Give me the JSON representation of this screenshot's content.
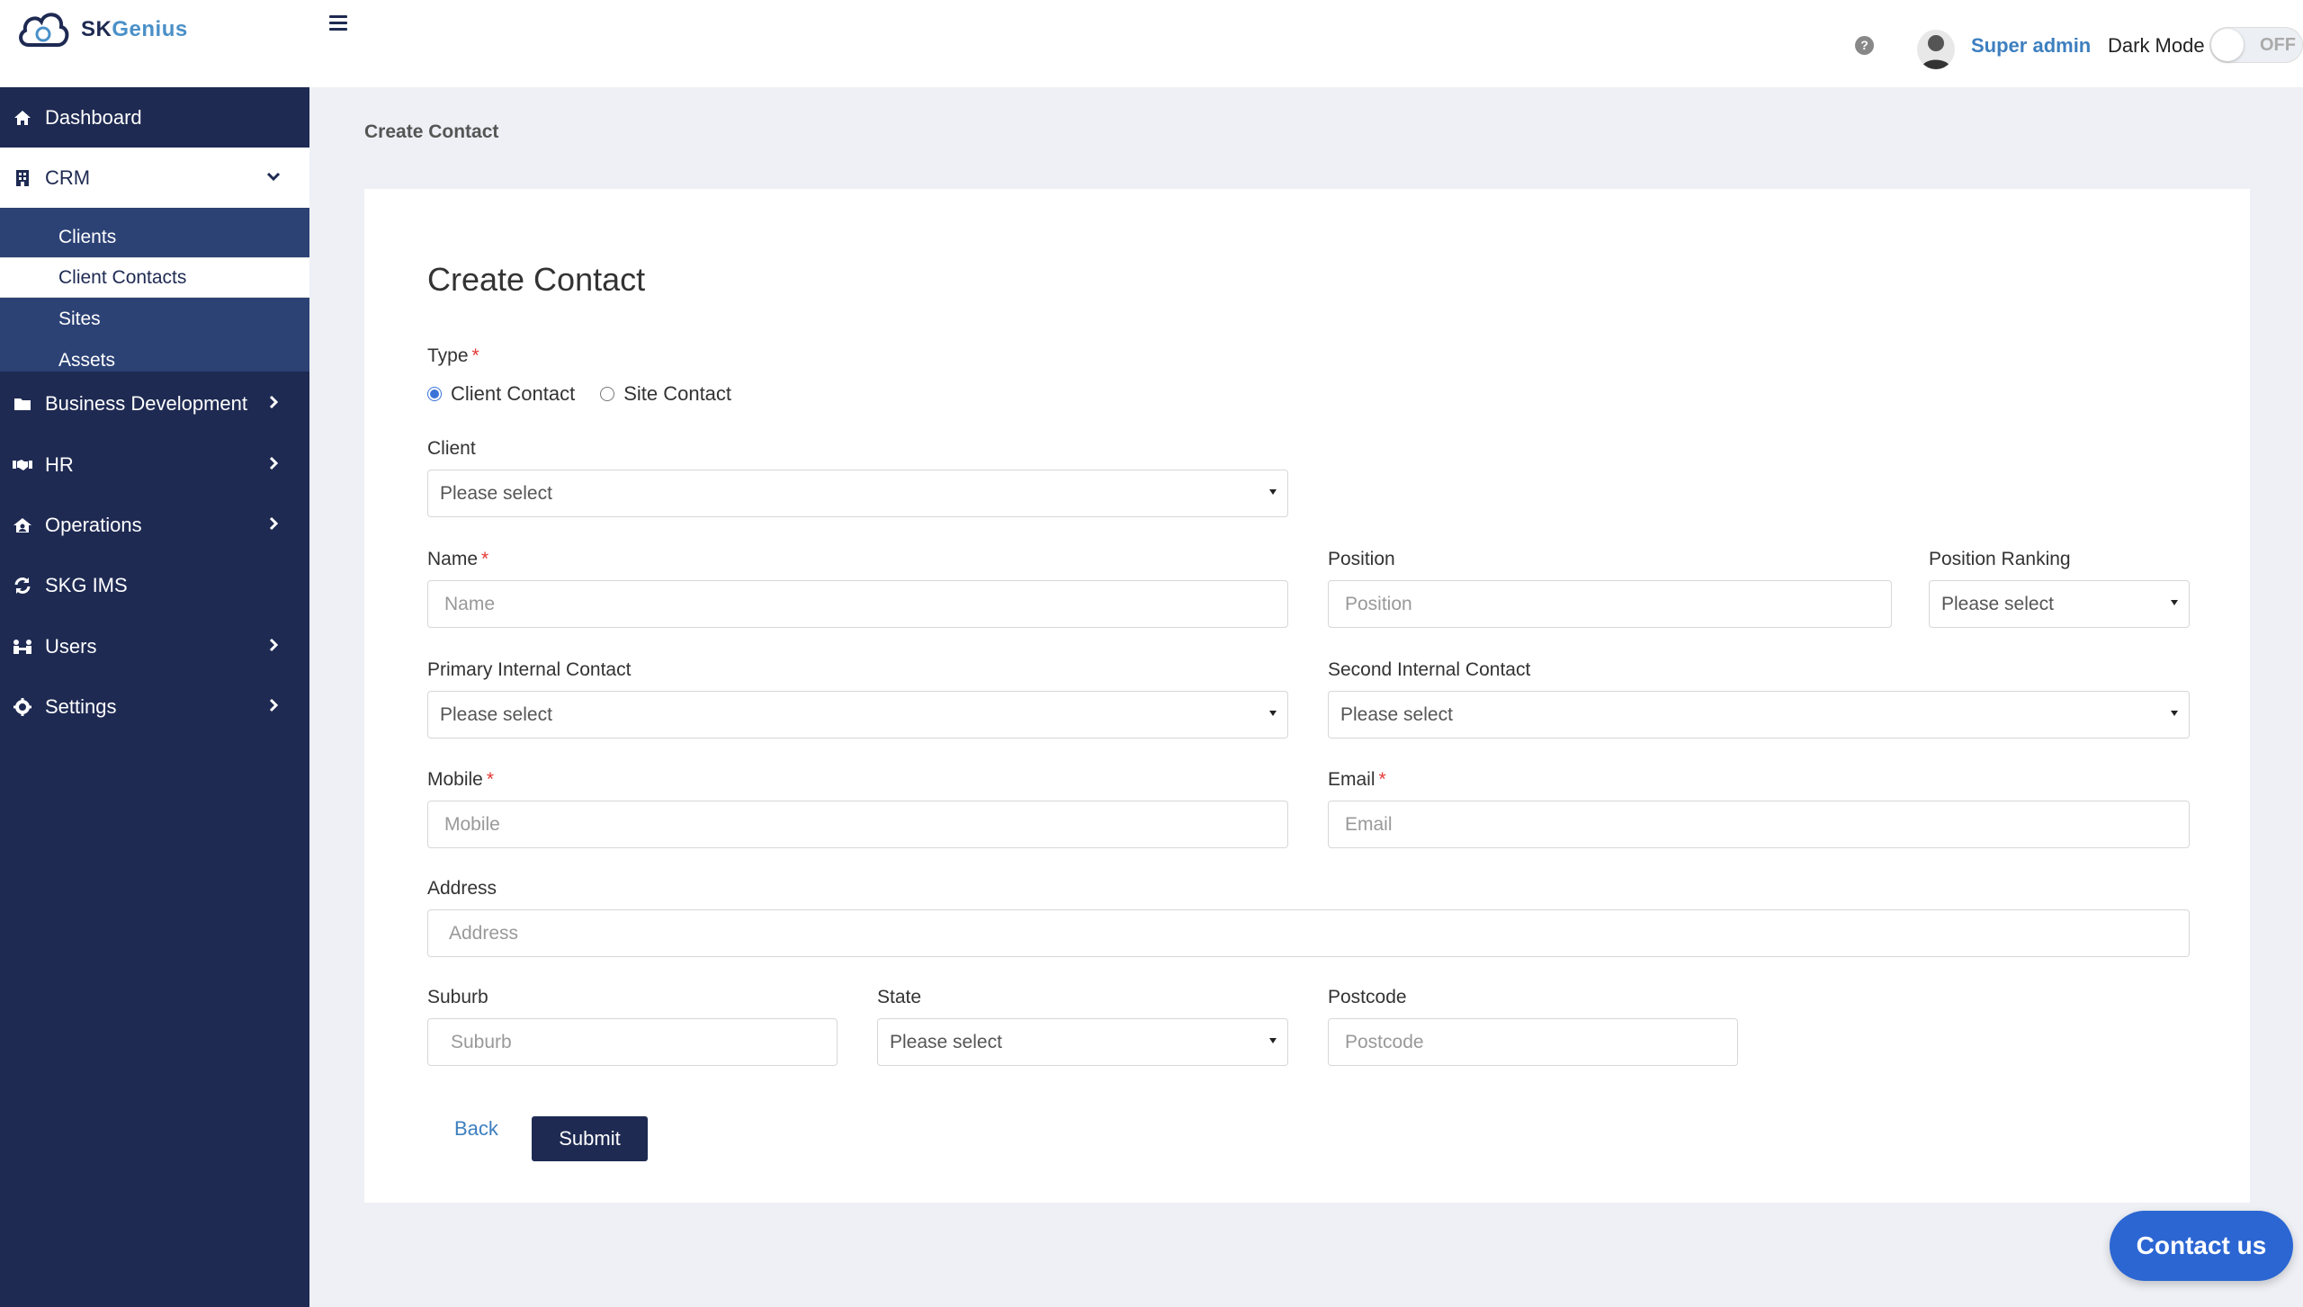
{
  "app": {
    "logo_prefix": "SK",
    "logo_suffix": "Genius"
  },
  "header": {
    "username": "Super admin",
    "dark_mode_label": "Dark Mode",
    "dark_mode_state": "OFF"
  },
  "sidebar": {
    "items": [
      {
        "label": "Dashboard",
        "icon": "home-icon"
      },
      {
        "label": "CRM",
        "icon": "building-icon",
        "expanded": true
      },
      {
        "label": "Business Development",
        "icon": "folder-icon"
      },
      {
        "label": "HR",
        "icon": "handshake-icon"
      },
      {
        "label": "Operations",
        "icon": "house-user-icon"
      },
      {
        "label": "SKG IMS",
        "icon": "sync-icon"
      },
      {
        "label": "Users",
        "icon": "users-icon"
      },
      {
        "label": "Settings",
        "icon": "gear-icon"
      }
    ],
    "crm_sub": [
      "Clients",
      "Client Contacts",
      "Sites",
      "Assets"
    ],
    "active_sub": "Client Contacts"
  },
  "page": {
    "breadcrumb": "Create Contact",
    "title": "Create Contact"
  },
  "form": {
    "type_label": "Type",
    "type_options": [
      "Client Contact",
      "Site Contact"
    ],
    "type_selected": "Client Contact",
    "client_label": "Client",
    "client_value": "Please select",
    "name_label": "Name",
    "name_placeholder": "Name",
    "position_label": "Position",
    "position_placeholder": "Position",
    "position_ranking_label": "Position Ranking",
    "position_ranking_value": "Please select",
    "primary_contact_label": "Primary Internal Contact",
    "primary_contact_value": "Please select",
    "second_contact_label": "Second Internal Contact",
    "second_contact_value": "Please select",
    "mobile_label": "Mobile",
    "mobile_placeholder": "Mobile",
    "email_label": "Email",
    "email_placeholder": "Email",
    "address_label": "Address",
    "address_placeholder": "Address",
    "suburb_label": "Suburb",
    "suburb_placeholder": "Suburb",
    "state_label": "State",
    "state_value": "Please select",
    "postcode_label": "Postcode",
    "postcode_placeholder": "Postcode",
    "required_mark": "*",
    "back_label": "Back",
    "submit_label": "Submit"
  },
  "contact_us": "Contact us",
  "colors": {
    "sidebar": "#1e2a52",
    "sub_menu": "#2c4275",
    "accent": "#3d7fbf",
    "contact_button": "#2b66d3",
    "required": "#e53935"
  }
}
